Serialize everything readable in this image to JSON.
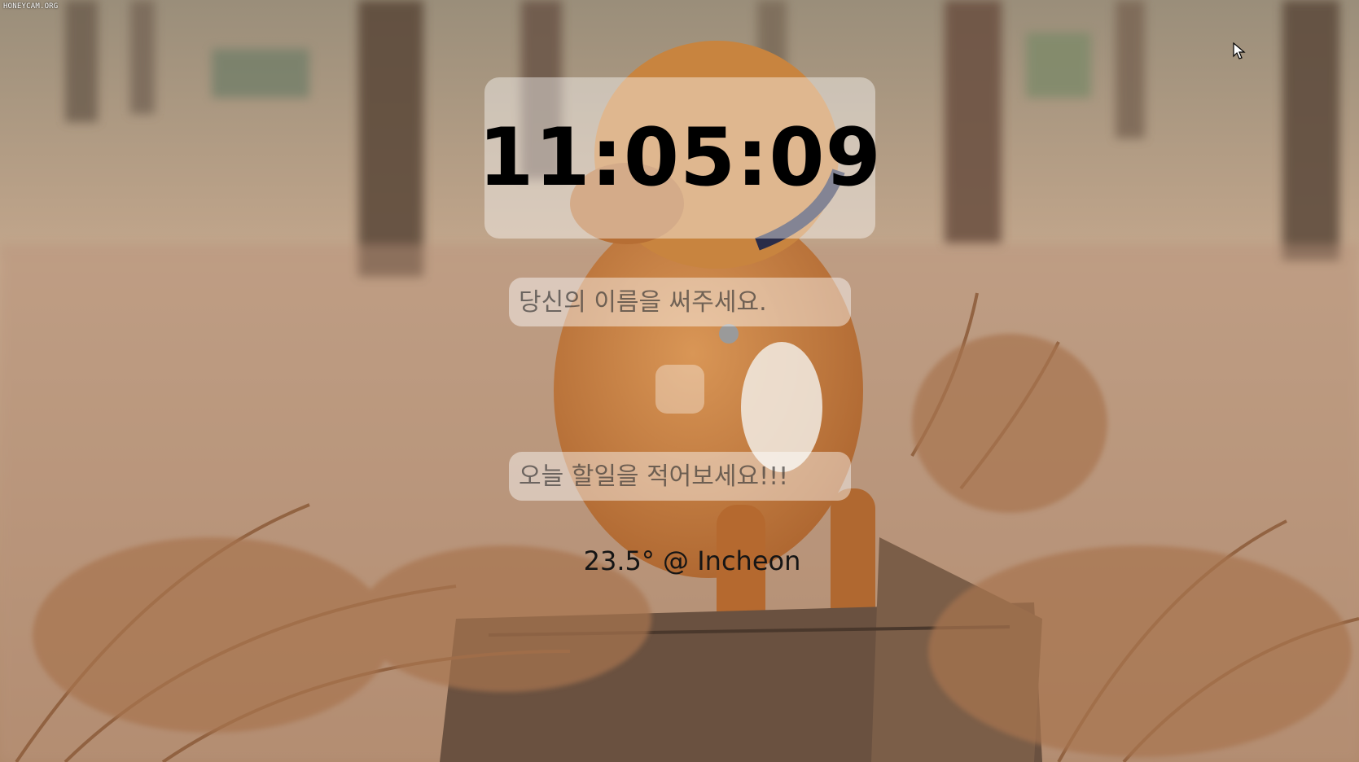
{
  "watermark": "HONEYCAM.ORG",
  "clock": {
    "time": "11:05:09"
  },
  "name_input": {
    "placeholder": "당신의 이름을 써주세요."
  },
  "todo_input": {
    "placeholder": "오늘 할일을 적어보세요!!!"
  },
  "weather": {
    "text": "23.5° @ Incheon"
  },
  "colors": {
    "panel": "rgba(255,255,255,0.42)",
    "text": "#000000",
    "dog_fur": "#c07a3c",
    "fern": "#9a6a48"
  },
  "icons": [
    "mouse-cursor-icon"
  ]
}
